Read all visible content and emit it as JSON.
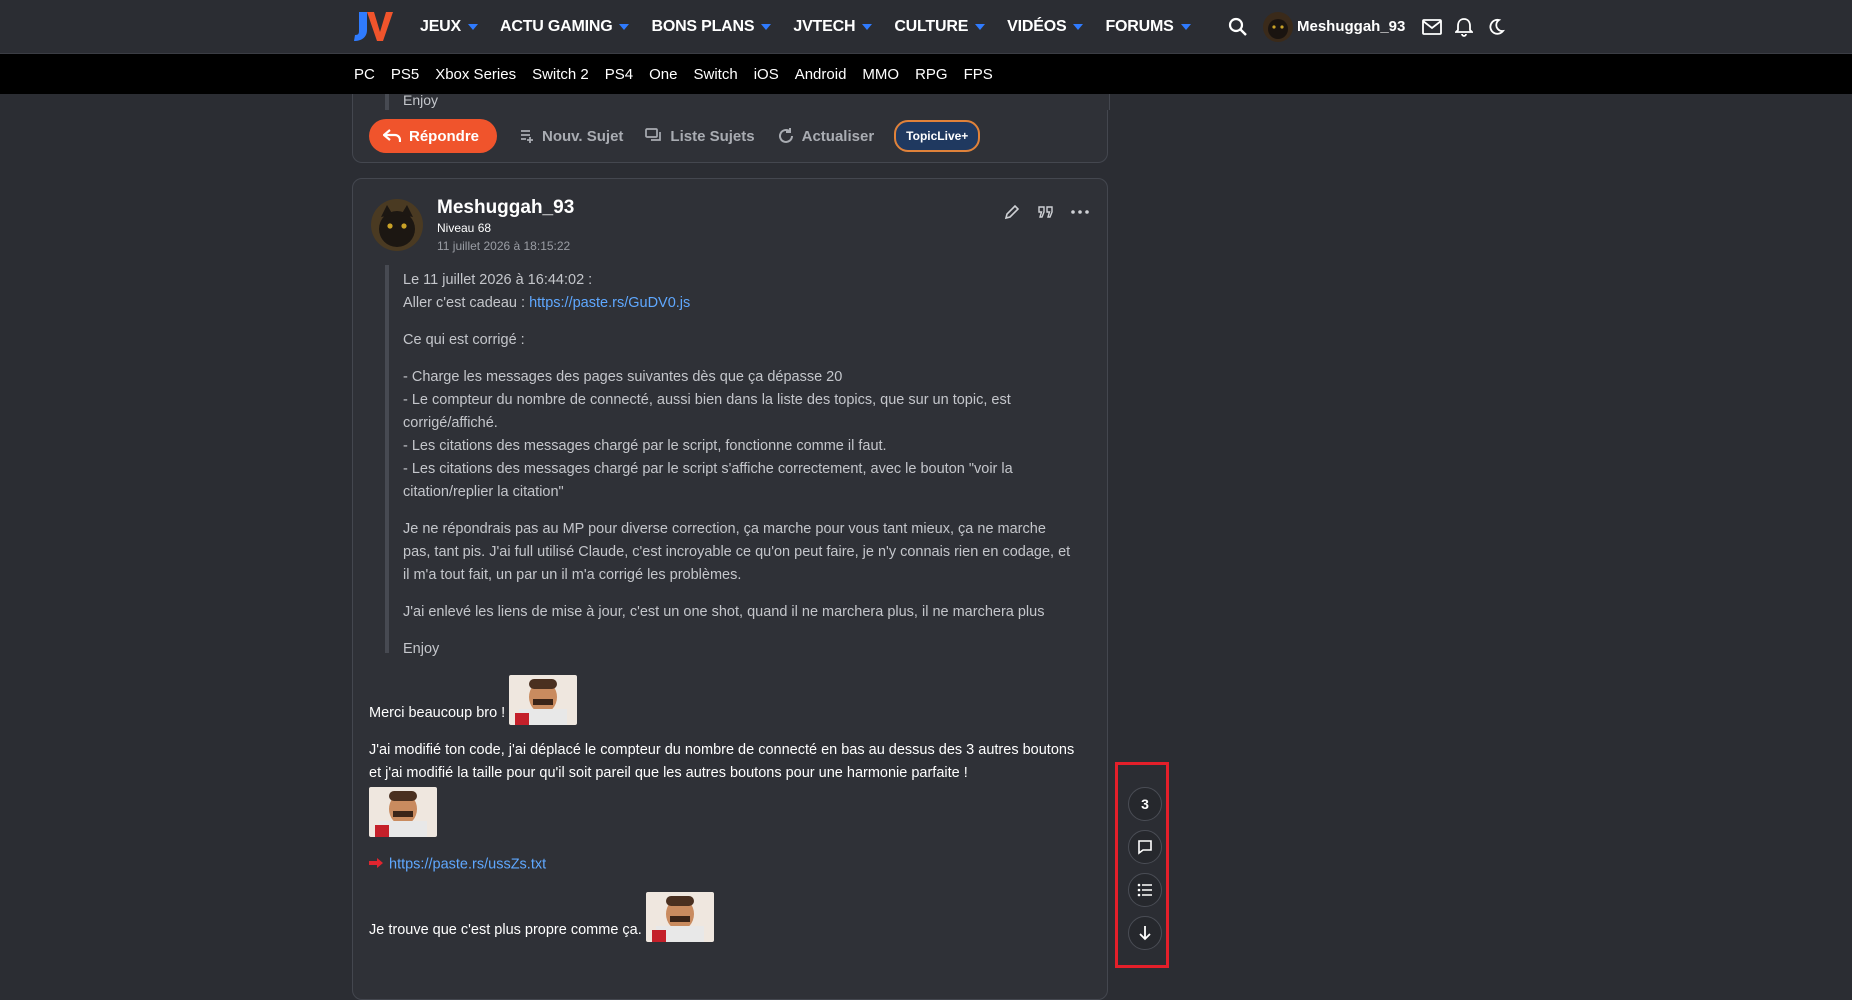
{
  "header": {
    "nav": [
      {
        "label": "JEUX"
      },
      {
        "label": "ACTU GAMING"
      },
      {
        "label": "BONS PLANS"
      },
      {
        "label": "JVTECH"
      },
      {
        "label": "CULTURE"
      },
      {
        "label": "VIDÉOS"
      },
      {
        "label": "FORUMS"
      }
    ],
    "username": "Meshuggah_93",
    "icons": [
      "search-icon",
      "mail-icon",
      "bell-icon",
      "moon-icon"
    ]
  },
  "platforms": [
    "PC",
    "PS5",
    "Xbox Series",
    "Switch 2",
    "PS4",
    "One",
    "Switch",
    "iOS",
    "Android",
    "MMO",
    "RPG",
    "FPS"
  ],
  "prev_post": {
    "tail": "Enjoy"
  },
  "actions": {
    "reply": "Répondre",
    "new_topic": "Nouv. Sujet",
    "topic_list": "Liste Sujets",
    "refresh": "Actualiser",
    "topiclive": "TopicLive+"
  },
  "post": {
    "author": "Meshuggah_93",
    "level": "Niveau 68",
    "date": "11 juillet 2026 à 18:15:22",
    "quote": {
      "header": "Le 11 juillet 2026 à 16:44:02 :",
      "intro": "Aller c'est cadeau : ",
      "link": "https://paste.rs/GuDV0.js",
      "fixed_title": "Ce qui est corrigé :",
      "fix1": "- Charge les messages des pages suivantes dès que ça dépasse 20",
      "fix2": "- Le compteur du nombre de connecté, aussi bien dans la liste des topics, que sur un topic, est corrigé/affiché.",
      "fix3": "- Les citations des messages chargé par le script, fonctionne comme il faut.",
      "fix4": "- Les citations des messages chargé par le script s'affiche correctement, avec le bouton \"voir la citation/replier la citation\"",
      "para2": "Je ne répondrais pas au MP pour diverse correction, ça marche pour vous tant mieux, ça ne marche pas, tant pis. J'ai full utilisé Claude, c'est incroyable ce qu'on peut faire, je n'y connais rien en codage, et il m'a tout fait, un par un il m'a corrigé les problèmes.",
      "para3": "J'ai enlevé les liens de mise à jour, c'est un one shot, quand il ne marchera plus, il ne marchera plus",
      "outro": "Enjoy"
    },
    "reply": {
      "thanks": "Merci beaucoup bro ! ",
      "text1": "J'ai modifié ton code, j'ai déplacé le compteur du nombre de connecté en bas au dessus des 3 autres boutons et j'ai modifié la taille pour qu'il soit pareil que les autres boutons pour une harmonie parfaite !",
      "link": "https://paste.rs/ussZs.txt",
      "text2": "Je trouve que c'est plus propre comme ça. "
    }
  },
  "floating": {
    "count": "3",
    "icons": [
      "chat-bubble-icon",
      "list-icon",
      "arrow-down-icon"
    ]
  },
  "colors": {
    "accent": "#f0542c",
    "link": "#5fa8ff",
    "highlight": "#e41f2a",
    "brand_blue": "#2f7bff"
  }
}
